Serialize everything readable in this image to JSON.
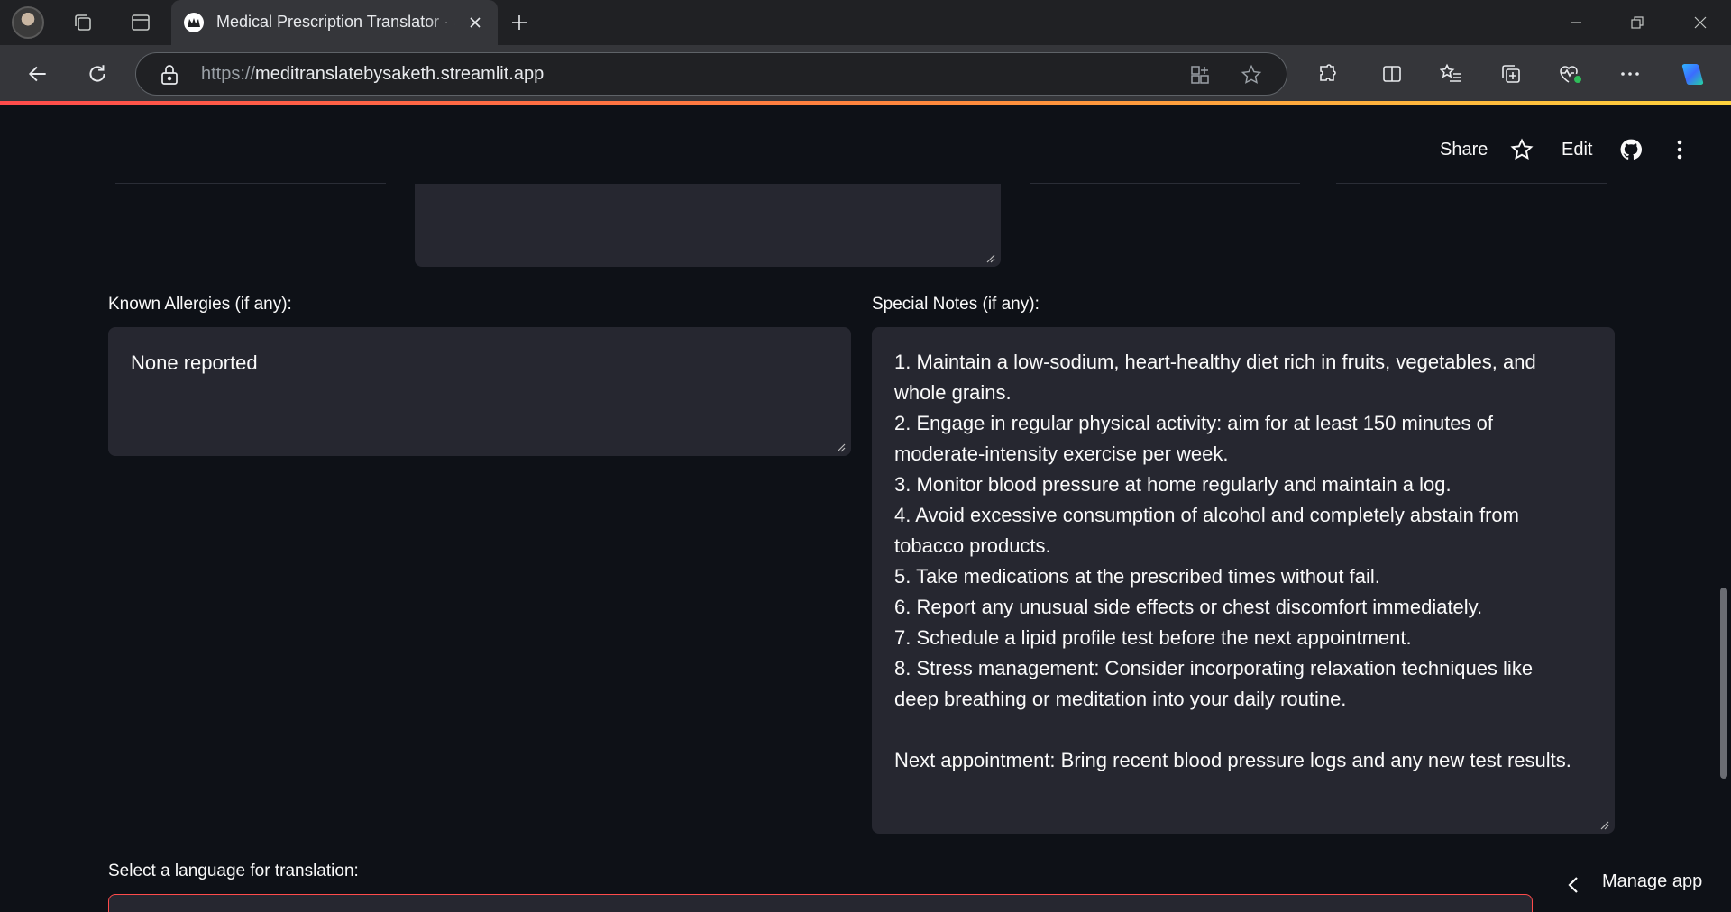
{
  "browser": {
    "tab_title": "Medical Prescription Translator · Streamlit",
    "url_scheme": "https://",
    "url_host": "meditranslatebysaketh.streamlit.app"
  },
  "app_header": {
    "share_label": "Share",
    "edit_label": "Edit"
  },
  "form": {
    "allergies_label": "Known Allergies (if any):",
    "allergies_value": "None reported",
    "notes_label": "Special Notes (if any):",
    "notes_value": "1. Maintain a low-sodium, heart-healthy diet rich in fruits, vegetables, and\nwhole grains.\n2. Engage in regular physical activity: aim for at least 150 minutes of\nmoderate-intensity exercise per week.\n3. Monitor blood pressure at home regularly and maintain a log.\n4. Avoid excessive consumption of alcohol and completely abstain from\ntobacco products.\n5. Take medications at the prescribed times without fail.\n6. Report any unusual side effects or chest discomfort immediately.\n7. Schedule a lipid profile test before the next appointment.\n8. Stress management: Consider incorporating relaxation techniques like\ndeep breathing or meditation into your daily routine.\n\nNext appointment: Bring recent blood pressure logs and any new test results.",
    "language_label": "Select a language for translation:"
  },
  "manage_app_label": "Manage app",
  "colors": {
    "app_bg": "#0e1117",
    "input_bg": "#262730",
    "accent": "#ff4b4b"
  }
}
